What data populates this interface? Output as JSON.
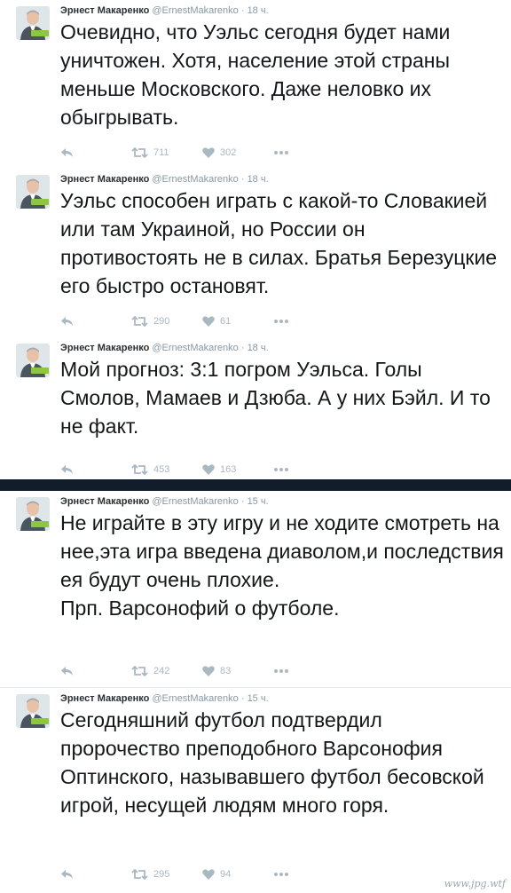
{
  "author": {
    "name": "Эрнест Макаренко",
    "handle": "@ErnestMakarenko",
    "separator": "·",
    "avatar_badge": "Единороссы"
  },
  "tweets": [
    {
      "time": "18 ч.",
      "text": "Очевидно, что Уэльс сегодня будет нами уничтожен. Хотя, население этой страны меньше Московского. Даже неловко их обыгрывать.",
      "retweets": "711",
      "likes": "302"
    },
    {
      "time": "18 ч.",
      "text": "Уэльс способен играть с какой-то Словакией или там Украиной, но России он противостоять не в силах. Братья Березуцкие его быстро остановят.",
      "retweets": "290",
      "likes": "61"
    },
    {
      "time": "18 ч.",
      "text": "Мой прогноз: 3:1 погром Уэльса. Голы Смолов, Мамаев и Дзюба. А у них Бэйл. И то не факт.",
      "retweets": "453",
      "likes": "163"
    },
    {
      "time": "15 ч.",
      "text": "Не играйте в эту игру и не ходите смотреть на нее,эта игра введена диаволом,и последствия ея будут очень плохие.\nПрп. Варсонофий о футболе.",
      "retweets": "242",
      "likes": "83"
    },
    {
      "time": "15 ч.",
      "text": "Сегодняшний футбол подтвердил пророчество преподобного Варсонофия Оптинского, называвшего футбол бесовской игрой, несущей людям много горя.",
      "retweets": "295",
      "likes": "94"
    }
  ],
  "watermark": "www.jpg.wtf",
  "colors": {
    "text": "#14171a",
    "name": "#292f33",
    "muted": "#8899a6",
    "action": "#aab8c2",
    "dark_bar": "#131c2b",
    "badge_green": "#8dc63f"
  },
  "icons": {
    "reply": "reply-icon",
    "retweet": "retweet-icon",
    "like": "heart-icon",
    "more": "more-dots-icon"
  }
}
